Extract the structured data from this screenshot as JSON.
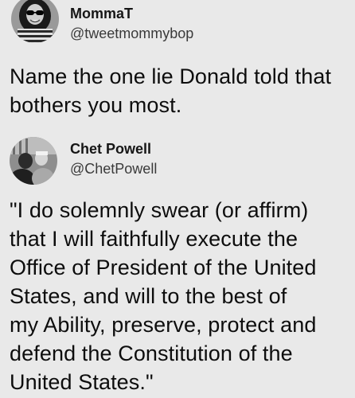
{
  "tweets": [
    {
      "display_name": "MommaT",
      "username": "@tweetmommybop",
      "avatar_icon": "profile-photo-icon",
      "text_lines": [
        "Name the one lie Donald told that",
        "bothers you most."
      ]
    },
    {
      "display_name": "Chet Powell",
      "username": "@ChetPowell",
      "avatar_icon": "profile-photo-icon",
      "text_lines": [
        "\"I do solemnly swear (or affirm)",
        "that I will faithfully execute the",
        "Office of President of the United",
        "States, and will to the best of",
        "my Ability, preserve, protect and",
        "defend the Constitution of the",
        "United States.\""
      ]
    }
  ],
  "colors": {
    "background": "#e9e9e9",
    "text": "#111111",
    "secondary_text": "#3a3a3a"
  }
}
